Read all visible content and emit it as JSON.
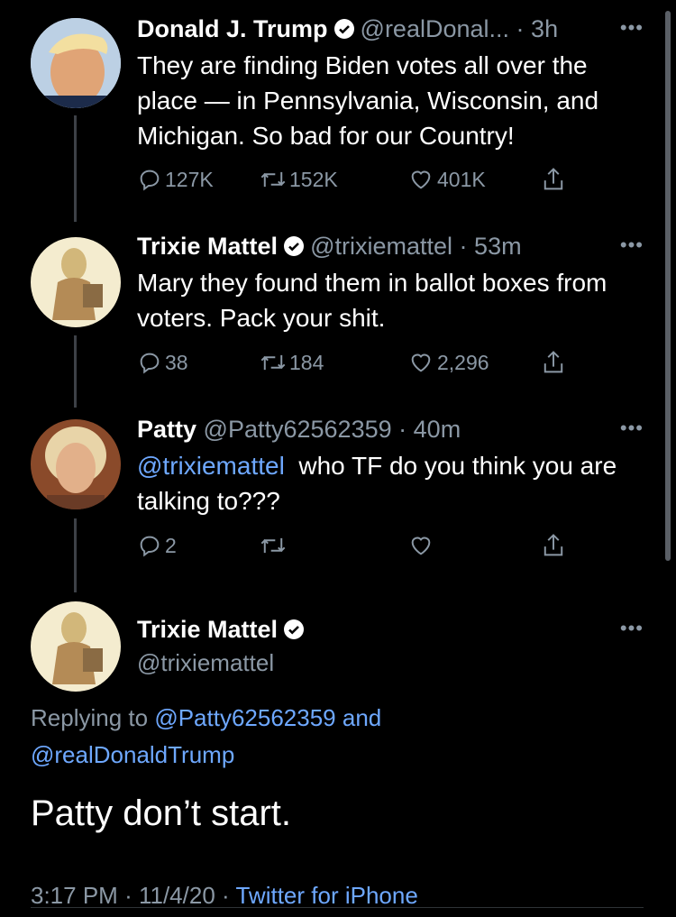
{
  "tweets": [
    {
      "name": "Donald J. Trump",
      "handle": "@realDonal...",
      "time": "3h",
      "text": "They are finding Biden votes all over the place — in Pennsylvania, Wisconsin, and Michigan. So bad for our Country!",
      "replies": "127K",
      "retweets": "152K",
      "likes": "401K"
    },
    {
      "name": "Trixie Mattel",
      "handle": "@trixiemattel",
      "time": "53m",
      "text": "Mary they found them in ballot boxes from voters. Pack your shit.",
      "replies": "38",
      "retweets": "184",
      "likes": "2,296"
    },
    {
      "name": "Patty",
      "handle": "@Patty62562359",
      "time": "40m",
      "mention": "@trixiemattel",
      "text": "who TF do you think you are talking to???",
      "replies": "2",
      "retweets": "",
      "likes": ""
    }
  ],
  "main": {
    "name": "Trixie Mattel",
    "handle": "@trixiemattel",
    "replying_prefix": "Replying to",
    "reply_to_1": "@Patty62562359",
    "reply_and": "and",
    "reply_to_2": "@realDonaldTrump",
    "text": "Patty don’t start.",
    "time": "3:17 PM",
    "date": "11/4/20",
    "source": "Twitter for iPhone"
  },
  "symbols": {
    "separator": "·",
    "more": "•••"
  },
  "colors": {
    "link": "#6ea8ff",
    "muted": "#8b98a5",
    "background": "#000000"
  }
}
